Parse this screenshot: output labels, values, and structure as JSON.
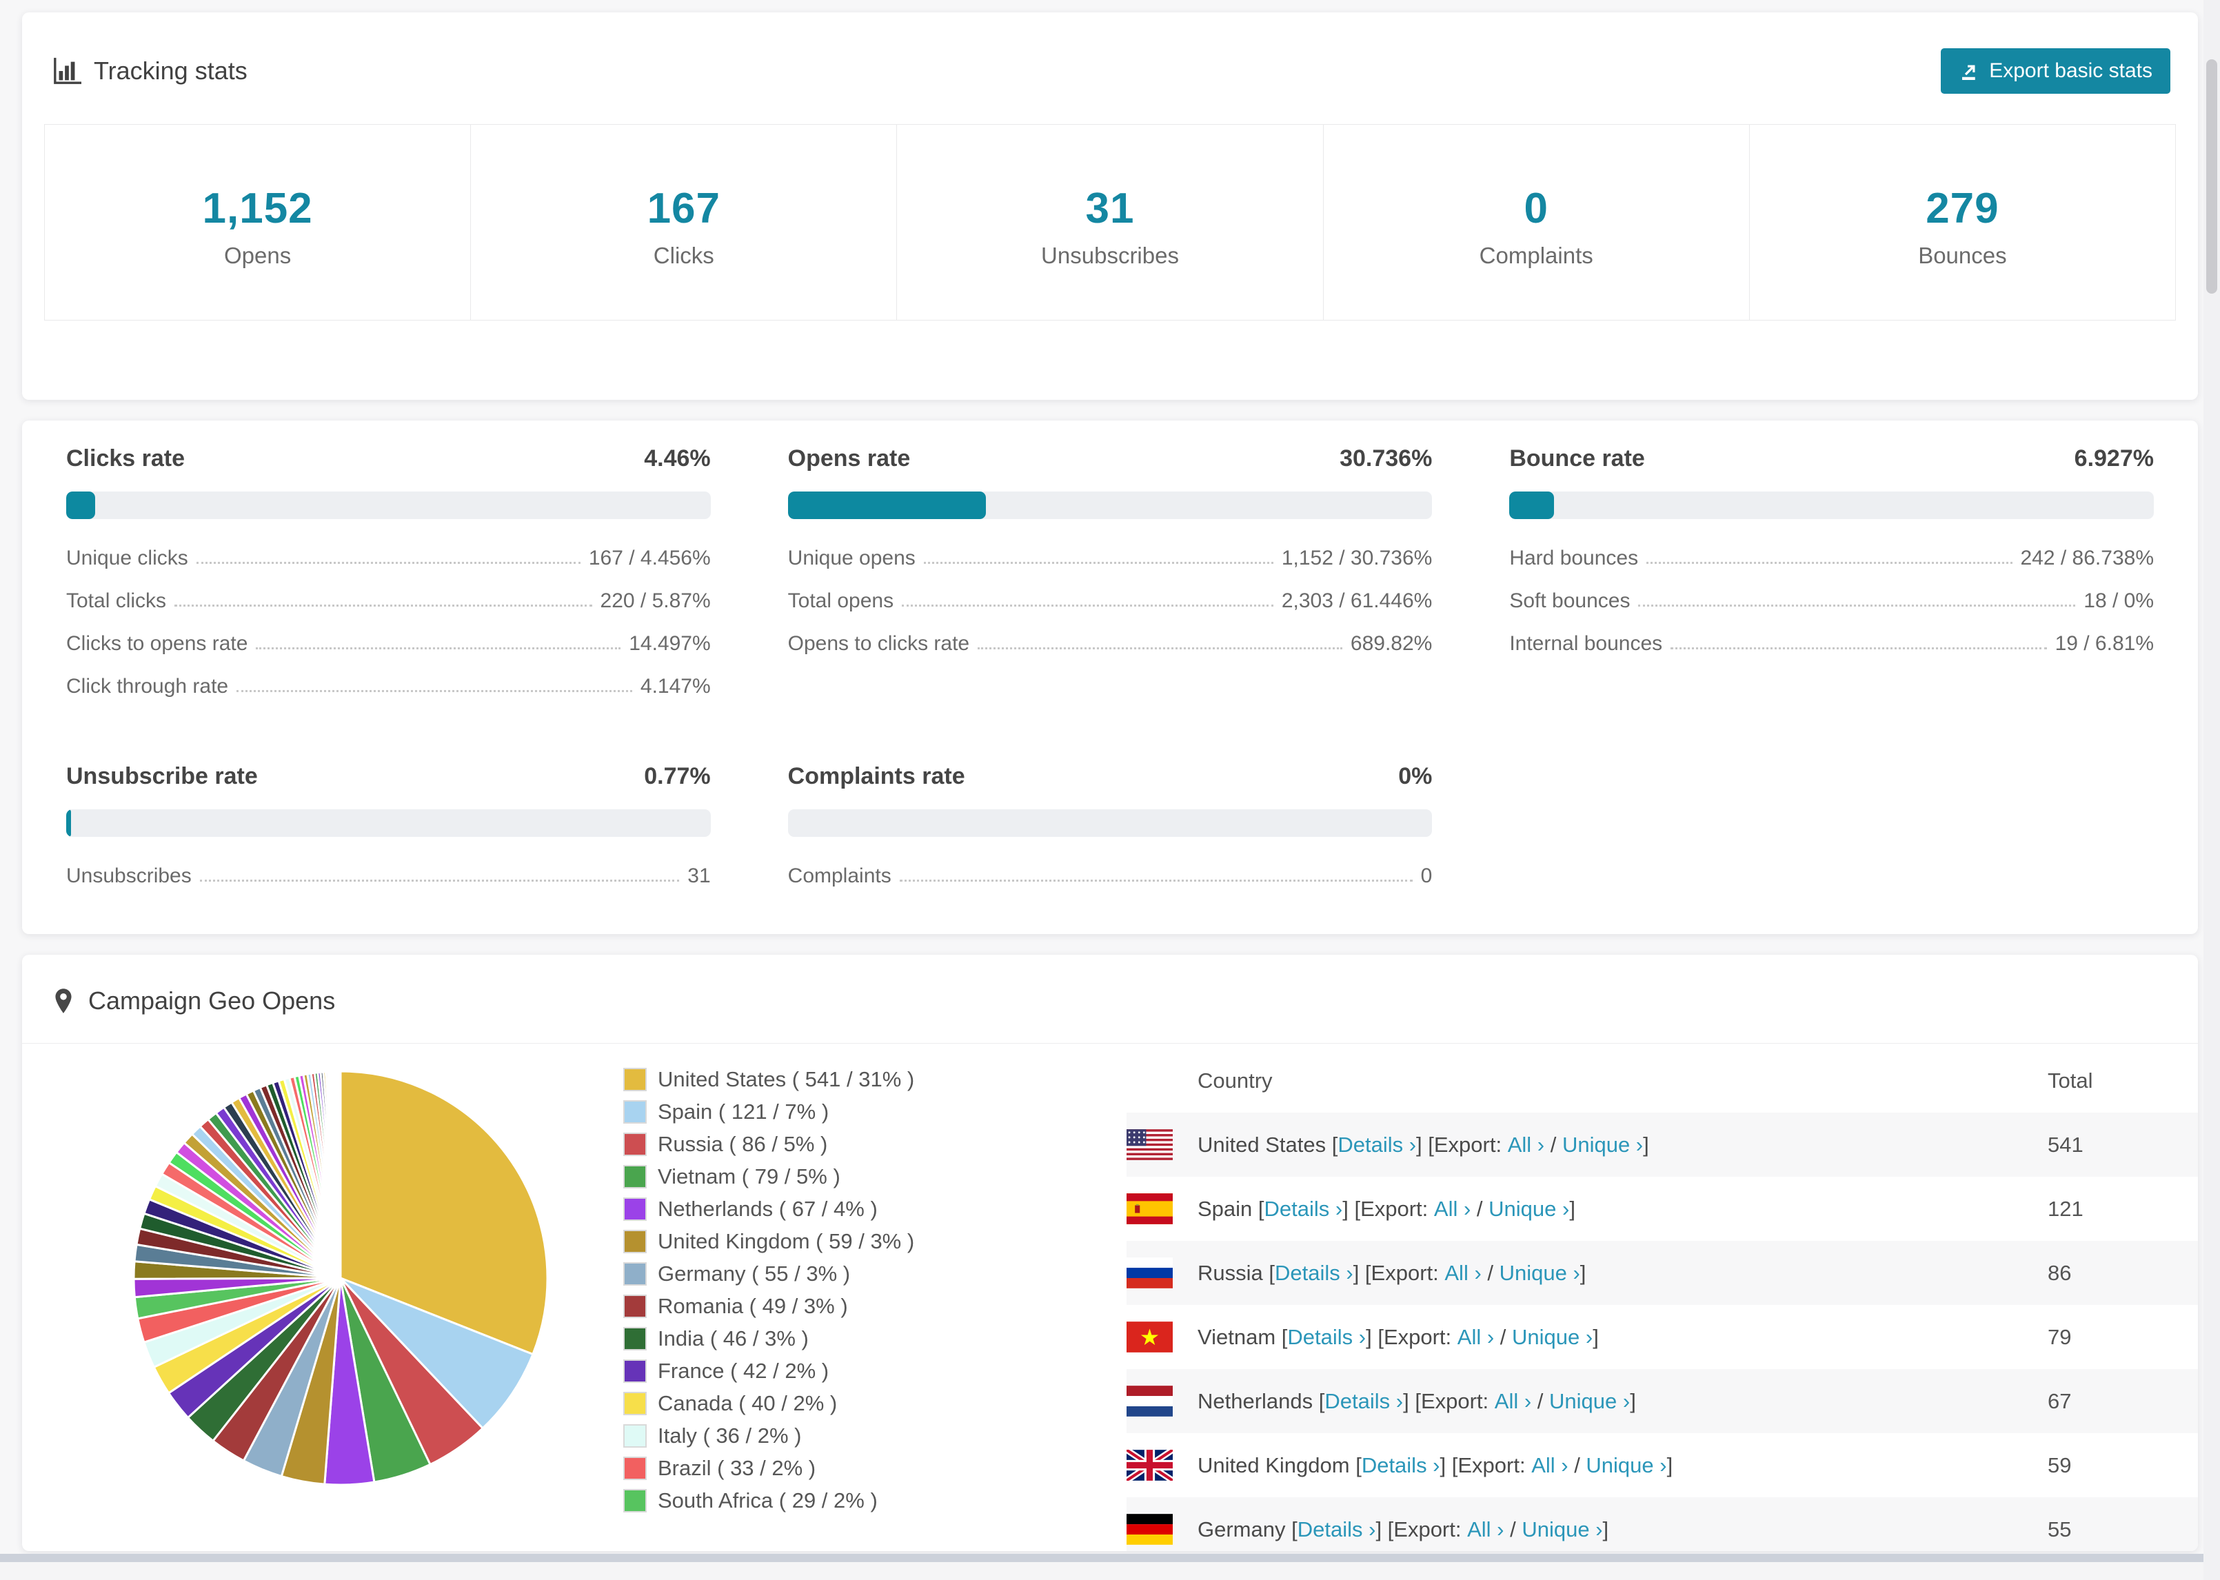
{
  "colors": {
    "accent_teal": "#1487a2",
    "progress_teal": "#0d89a0",
    "link_teal": "#2b96b9",
    "page_bg": "#f7f7f8",
    "bar_track": "#edeff2",
    "row_stripe": "#f7f7f8",
    "bottom_strip": "#ccd1da"
  },
  "tracking": {
    "title": "Tracking stats",
    "export_button_label": "Export basic stats",
    "stats": [
      {
        "value": "1,152",
        "label": "Opens"
      },
      {
        "value": "167",
        "label": "Clicks"
      },
      {
        "value": "31",
        "label": "Unsubscribes"
      },
      {
        "value": "0",
        "label": "Complaints"
      },
      {
        "value": "279",
        "label": "Bounces"
      }
    ]
  },
  "rates": {
    "blocks": [
      {
        "title": "Clicks rate",
        "value": "4.46%",
        "percent": 4.46,
        "rows": [
          {
            "label": "Unique clicks",
            "value": "167 / 4.456%"
          },
          {
            "label": "Total clicks",
            "value": "220 / 5.87%"
          },
          {
            "label": "Clicks to opens rate",
            "value": "14.497%"
          },
          {
            "label": "Click through rate",
            "value": "4.147%"
          }
        ]
      },
      {
        "title": "Opens rate",
        "value": "30.736%",
        "percent": 30.736,
        "rows": [
          {
            "label": "Unique opens",
            "value": "1,152 / 30.736%"
          },
          {
            "label": "Total opens",
            "value": "2,303 / 61.446%"
          },
          {
            "label": "Opens to clicks rate",
            "value": "689.82%"
          }
        ]
      },
      {
        "title": "Bounce rate",
        "value": "6.927%",
        "percent": 6.927,
        "rows": [
          {
            "label": "Hard bounces",
            "value": "242 / 86.738%"
          },
          {
            "label": "Soft bounces",
            "value": "18 / 0%"
          },
          {
            "label": "Internal bounces",
            "value": "19 / 6.81%"
          }
        ]
      },
      {
        "title": "Unsubscribe rate",
        "value": "0.77%",
        "percent": 0.77,
        "rows": [
          {
            "label": "Unsubscribes",
            "value": "31"
          }
        ]
      },
      {
        "title": "Complaints rate",
        "value": "0%",
        "percent": 0,
        "rows": [
          {
            "label": "Complaints",
            "value": "0"
          }
        ]
      }
    ]
  },
  "geo": {
    "title": "Campaign Geo Opens",
    "table": {
      "headers": [
        "Country",
        "Total"
      ],
      "details_label": "Details",
      "export_label": "Export:",
      "all_label": "All",
      "unique_label": "Unique",
      "chevron": "›",
      "bracket_open": "[",
      "bracket_close": "]",
      "slash": "/",
      "rows": [
        {
          "country": "United States",
          "total": "541",
          "flag": "us"
        },
        {
          "country": "Spain",
          "total": "121",
          "flag": "es"
        },
        {
          "country": "Russia",
          "total": "86",
          "flag": "ru"
        },
        {
          "country": "Vietnam",
          "total": "79",
          "flag": "vn"
        },
        {
          "country": "Netherlands",
          "total": "67",
          "flag": "nl"
        },
        {
          "country": "United Kingdom",
          "total": "59",
          "flag": "gb"
        },
        {
          "country": "Germany",
          "total": "55",
          "flag": "de"
        }
      ]
    }
  },
  "chart_data": {
    "type": "pie",
    "title": "Campaign Geo Opens",
    "legend_position": "right",
    "slices": [
      {
        "label": "United States",
        "value": 541,
        "pct": 31,
        "color": "#e3bb3f",
        "display": "United States ( 541 / 31% )"
      },
      {
        "label": "Spain",
        "value": 121,
        "pct": 7,
        "color": "#a8d3f0",
        "display": "Spain ( 121 / 7% )"
      },
      {
        "label": "Russia",
        "value": 86,
        "pct": 5,
        "color": "#cd4e51",
        "display": "Russia ( 86 / 5% )"
      },
      {
        "label": "Vietnam",
        "value": 79,
        "pct": 5,
        "color": "#4aa54e",
        "display": "Vietnam ( 79 / 5% )"
      },
      {
        "label": "Netherlands",
        "value": 67,
        "pct": 4,
        "color": "#9b42e8",
        "display": "Netherlands ( 67 / 4% )"
      },
      {
        "label": "United Kingdom",
        "value": 59,
        "pct": 3,
        "color": "#b5912f",
        "display": "United Kingdom ( 59 / 3% )"
      },
      {
        "label": "Germany",
        "value": 55,
        "pct": 3,
        "color": "#8fafc9",
        "display": "Germany ( 55 / 3% )"
      },
      {
        "label": "Romania",
        "value": 49,
        "pct": 3,
        "color": "#a33b3b",
        "display": "Romania ( 49 / 3% )"
      },
      {
        "label": "India",
        "value": 46,
        "pct": 3,
        "color": "#2f6e35",
        "display": "India ( 46 / 3% )"
      },
      {
        "label": "France",
        "value": 42,
        "pct": 2,
        "color": "#6633b8",
        "display": "France ( 42 / 2% )"
      },
      {
        "label": "Canada",
        "value": 40,
        "pct": 2,
        "color": "#f7df4a",
        "display": "Canada ( 40 / 2% )"
      },
      {
        "label": "Italy",
        "value": 36,
        "pct": 2,
        "color": "#dffaf6",
        "display": "Italy ( 36 / 2% )"
      },
      {
        "label": "Brazil",
        "value": 33,
        "pct": 2,
        "color": "#f26060",
        "display": "Brazil ( 33 / 2% )"
      },
      {
        "label": "South Africa",
        "value": 29,
        "pct": 2,
        "color": "#57c45f",
        "display": "South Africa ( 29 / 2% )"
      }
    ],
    "others_total": 462,
    "others_count": 55,
    "others_palette": [
      "#a134d6",
      "#8a7a1f",
      "#5a7d95",
      "#7e2a2a",
      "#1f5c2d",
      "#33217a",
      "#f4ef45",
      "#e7fbf7",
      "#f56a6a",
      "#4ede60",
      "#d14fe0",
      "#c3a136",
      "#a9d4f1",
      "#d04c4c",
      "#3f9b4e",
      "#7a3bd0",
      "#2c3e50",
      "#e3bb3f"
    ]
  }
}
